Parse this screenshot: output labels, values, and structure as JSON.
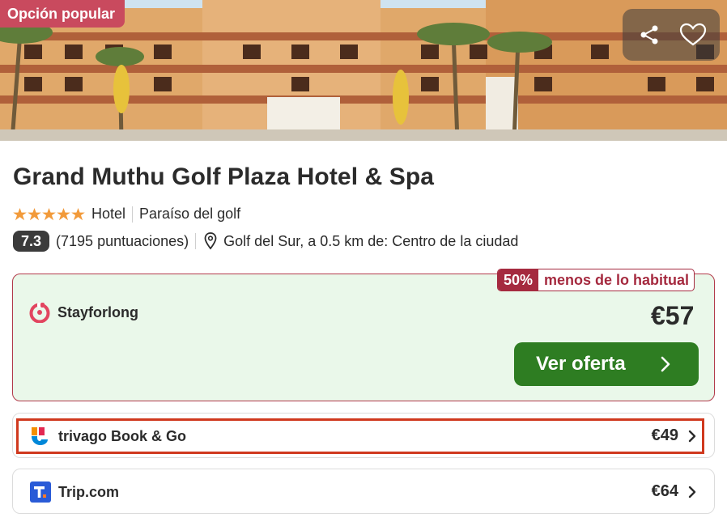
{
  "hero": {
    "badge": "Opción popular",
    "share_icon": "share-icon",
    "favorite_icon": "heart-icon"
  },
  "hotel": {
    "name": "Grand Muthu Golf Plaza Hotel & Spa",
    "stars": 5,
    "type": "Hotel",
    "tagline": "Paraíso del golf",
    "rating": "7.3",
    "reviews": "(7195 puntuaciones)",
    "location": "Golf del Sur, a 0.5 km de: Centro de la ciudad"
  },
  "deal": {
    "discount": "50%",
    "discount_text": "menos de lo habitual",
    "provider": "Stayforlong",
    "price": "€57",
    "cta": "Ver oferta"
  },
  "offers": [
    {
      "provider": "trivago Book & Go",
      "price": "€49"
    },
    {
      "provider": "Trip.com",
      "price": "€64"
    }
  ],
  "colors": {
    "star": "#f29a3a",
    "cta": "#2e7d22",
    "deal_bg": "#eaf8ea",
    "deal_accent": "#a52a3f",
    "highlight": "#d0391e"
  }
}
